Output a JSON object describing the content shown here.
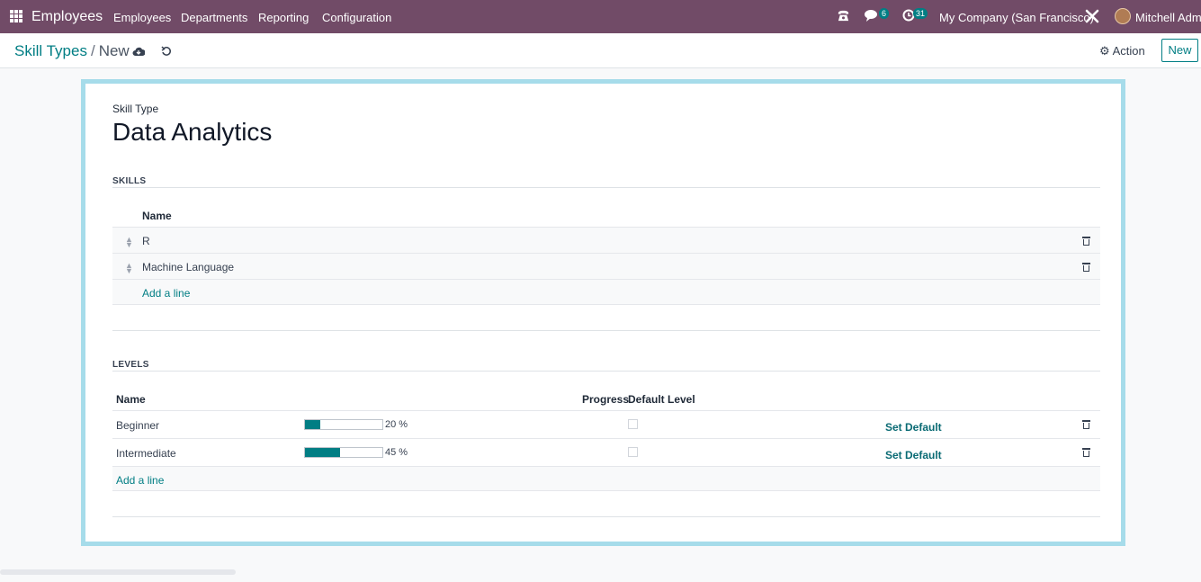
{
  "navbar": {
    "app_name": "Employees",
    "menu": [
      "Employees",
      "Departments",
      "Reporting",
      "Configuration"
    ],
    "messages_count": "6",
    "activities_count": "31",
    "company": "My Company (San Francisco)",
    "user": "Mitchell Admin"
  },
  "controlbar": {
    "breadcrumb_parent": "Skill Types",
    "breadcrumb_sep": "/",
    "breadcrumb_current": "New",
    "action_label": "Action",
    "new_label": "New"
  },
  "form": {
    "skill_type_label": "Skill Type",
    "skill_type_name": "Data Analytics",
    "skills_title": "SKILLS",
    "skills_header_name": "Name",
    "skills": [
      {
        "name": "R"
      },
      {
        "name": "Machine Language"
      }
    ],
    "skills_add_line": "Add a line",
    "levels_title": "LEVELS",
    "levels_header_name": "Name",
    "levels_header_progress": "Progress",
    "levels_header_default": "Default Level",
    "levels": [
      {
        "name": "Beginner",
        "progress": 20,
        "progress_text": "20 %",
        "default": false,
        "set_default": "Set Default"
      },
      {
        "name": "Intermediate",
        "progress": 45,
        "progress_text": "45 %",
        "default": false,
        "set_default": "Set Default"
      }
    ],
    "levels_add_line": "Add a line"
  },
  "colors": {
    "navbar": "#714b67",
    "accent": "#017e84",
    "sheet_border": "#a6dcea"
  }
}
